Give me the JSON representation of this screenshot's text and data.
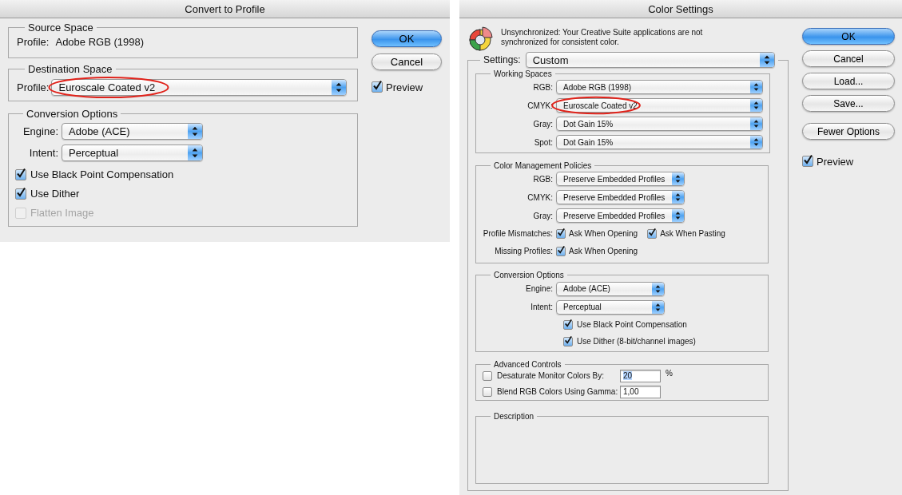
{
  "convert_to_profile": {
    "title": "Convert to Profile",
    "source_space": {
      "legend": "Source Space",
      "label": "Profile:",
      "value": "Adobe RGB (1998)"
    },
    "destination_space": {
      "legend": "Destination Space",
      "label": "Profile:",
      "value": "Euroscale Coated v2",
      "highlighted": true
    },
    "conversion_options": {
      "legend": "Conversion Options",
      "dropdowns": [
        {
          "label": "Engine:",
          "value": "Adobe (ACE)"
        },
        {
          "label": "Intent:",
          "value": "Perceptual"
        }
      ],
      "checkboxes": [
        {
          "label": "Use Black Point Compensation",
          "checked": true,
          "disabled": false
        },
        {
          "label": "Use Dither",
          "checked": true,
          "disabled": false
        },
        {
          "label": "Flatten Image",
          "checked": false,
          "disabled": true
        }
      ]
    },
    "buttons": [
      {
        "label": "OK",
        "default": true
      },
      {
        "label": "Cancel",
        "default": false
      }
    ],
    "preview": {
      "label": "Preview",
      "checked": true
    }
  },
  "color_settings": {
    "title": "Color Settings",
    "sync_message": "Unsynchronized: Your Creative Suite applications are not synchronized for consistent color.",
    "settings": {
      "label": "Settings:",
      "value": "Custom"
    },
    "working_spaces": {
      "legend": "Working Spaces",
      "rows": [
        {
          "label": "RGB:",
          "value": "Adobe RGB (1998)",
          "highlighted": false
        },
        {
          "label": "CMYK:",
          "value": "Euroscale Coated v2",
          "highlighted": true
        },
        {
          "label": "Gray:",
          "value": "Dot Gain 15%",
          "highlighted": false
        },
        {
          "label": "Spot:",
          "value": "Dot Gain 15%",
          "highlighted": false
        }
      ]
    },
    "color_management_policies": {
      "legend": "Color Management Policies",
      "rows": [
        {
          "label": "RGB:",
          "value": "Preserve Embedded Profiles"
        },
        {
          "label": "CMYK:",
          "value": "Preserve Embedded Profiles"
        },
        {
          "label": "Gray:",
          "value": "Preserve Embedded Profiles"
        }
      ],
      "checkbox_rows": [
        {
          "label": "Profile Mismatches:",
          "options": [
            {
              "label": "Ask When Opening",
              "checked": true
            },
            {
              "label": "Ask When Pasting",
              "checked": true
            }
          ]
        },
        {
          "label": "Missing Profiles:",
          "options": [
            {
              "label": "Ask When Opening",
              "checked": true
            }
          ]
        }
      ]
    },
    "conversion_options": {
      "legend": "Conversion Options",
      "dropdowns": [
        {
          "label": "Engine:",
          "value": "Adobe (ACE)"
        },
        {
          "label": "Intent:",
          "value": "Perceptual"
        }
      ],
      "checkboxes": [
        {
          "label": "Use Black Point Compensation",
          "checked": true
        },
        {
          "label": "Use Dither (8-bit/channel images)",
          "checked": true
        }
      ]
    },
    "advanced_controls": {
      "legend": "Advanced Controls",
      "rows": [
        {
          "label": "Desaturate Monitor Colors By:",
          "checked": false,
          "value": "20",
          "value_selected": true,
          "unit": "%"
        },
        {
          "label": "Blend RGB Colors Using Gamma:",
          "checked": false,
          "value": "1,00",
          "value_selected": false
        }
      ]
    },
    "description": {
      "legend": "Description"
    },
    "buttons": [
      {
        "label": "OK",
        "default": true
      },
      {
        "label": "Cancel",
        "default": false
      },
      {
        "label": "Load...",
        "default": false
      },
      {
        "label": "Save...",
        "default": false
      },
      {
        "label": "Fewer Options",
        "default": false
      }
    ],
    "preview": {
      "label": "Preview",
      "checked": true
    }
  }
}
